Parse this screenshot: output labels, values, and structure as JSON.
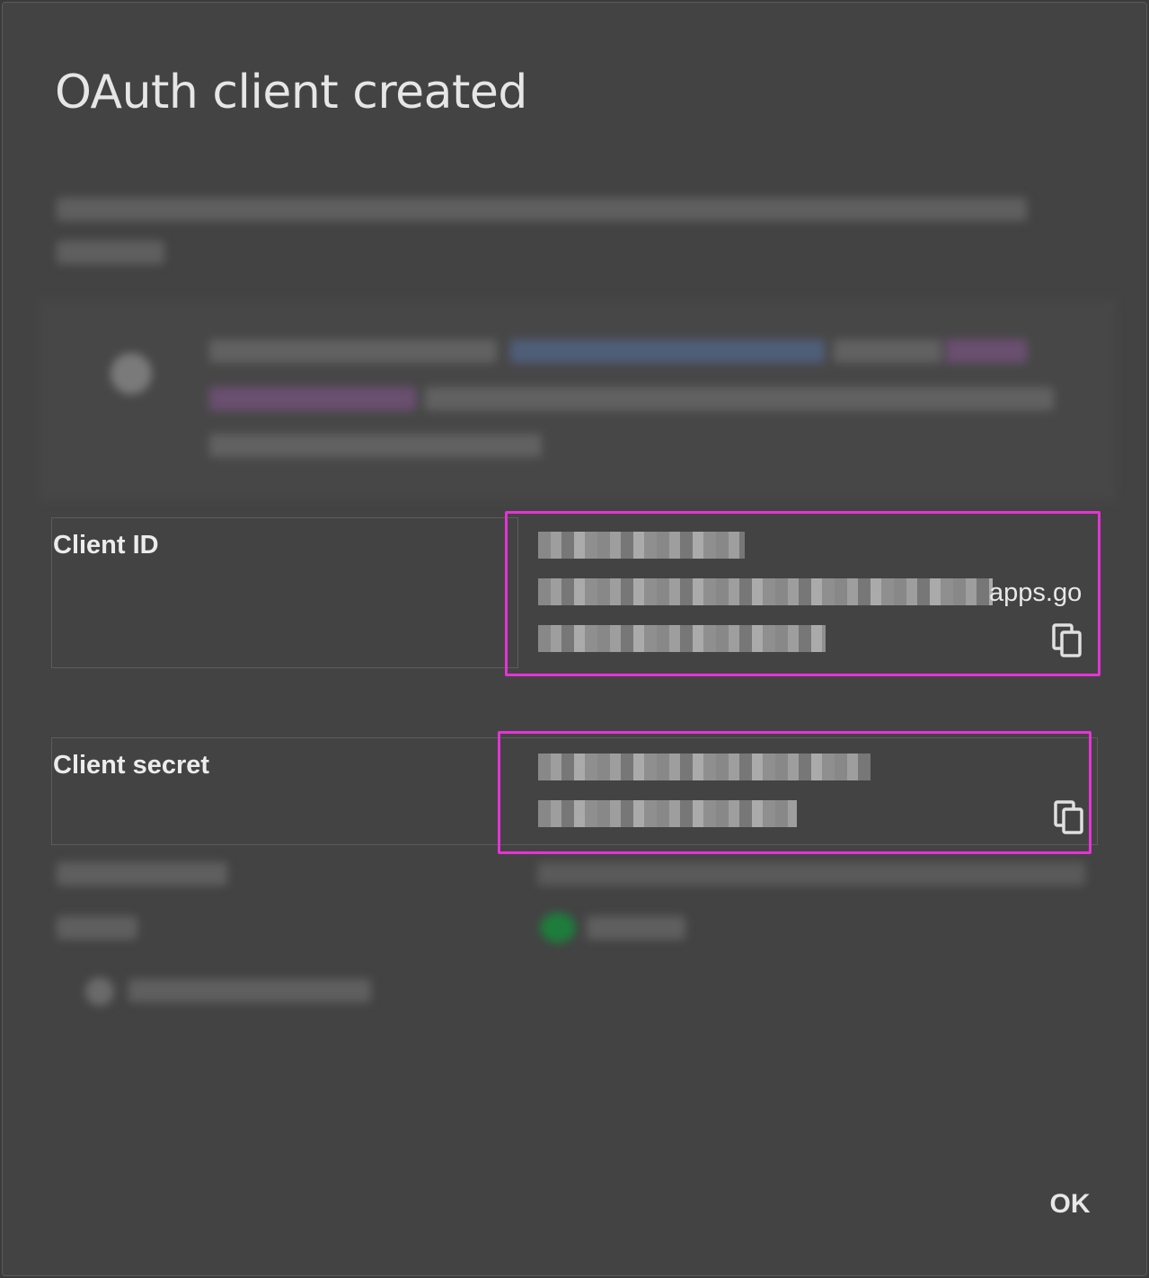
{
  "dialog": {
    "title": "OAuth client created",
    "ok_label": "OK"
  },
  "client_id": {
    "label": "Client ID",
    "value_visible_suffix": "apps.go",
    "copy_icon": "copy-icon"
  },
  "client_secret": {
    "label": "Client secret",
    "copy_icon": "copy-icon"
  },
  "colors": {
    "dialog_bg": "#434343",
    "highlight": "#e633d6",
    "link": "#5b7fb5",
    "status_green": "#1e7d3c"
  }
}
